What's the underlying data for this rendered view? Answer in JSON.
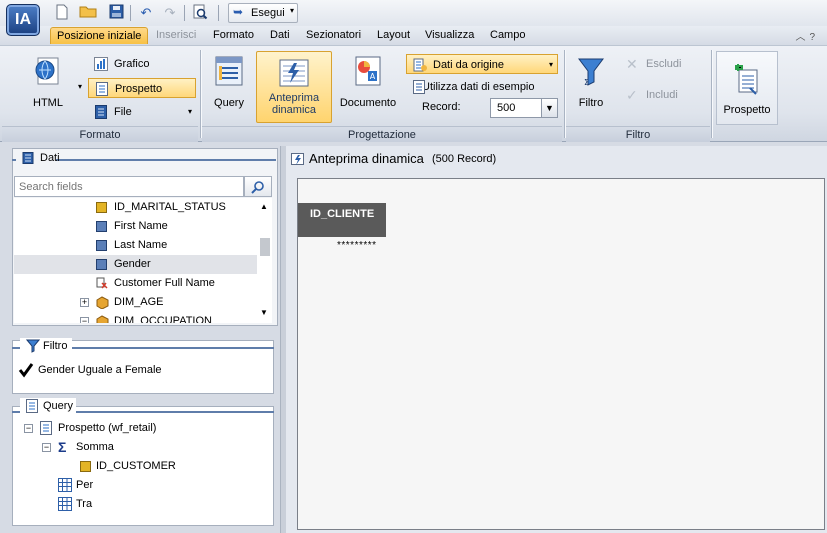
{
  "app": {
    "logo_text": "IA"
  },
  "quick_access": {
    "run_label": "Esegui"
  },
  "menu": {
    "tabs": [
      "Posizione iniziale",
      "Inserisci",
      "Formato",
      "Dati",
      "Sezionatori",
      "Layout",
      "Visualizza",
      "Campo"
    ],
    "active": "Posizione iniziale",
    "disabled": [
      "Inserisci"
    ]
  },
  "ribbon": {
    "formato": {
      "label": "Formato",
      "html": "HTML",
      "grafico": "Grafico",
      "prospetto": "Prospetto",
      "file": "File"
    },
    "progettazione": {
      "label": "Progettazione",
      "query": "Query",
      "anteprima_line1": "Anteprima",
      "anteprima_line2": "dinamica",
      "documento": "Documento",
      "dati_da_origine": "Dati da origine",
      "utilizza_dati": "Utilizza dati di esempio",
      "record_label": "Record:",
      "record_value": "500"
    },
    "filtro": {
      "label": "Filtro",
      "filtro": "Filtro",
      "escludi": "Escludi",
      "includi": "Includi"
    },
    "output": {
      "prospetto": "Prospetto"
    }
  },
  "left": {
    "dati": {
      "title": "Dati",
      "search_placeholder": "Search fields",
      "fields": [
        {
          "label": "ID_MARITAL_STATUS",
          "type": "key"
        },
        {
          "label": "First Name",
          "type": "dim"
        },
        {
          "label": "Last Name",
          "type": "dim"
        },
        {
          "label": "Gender",
          "type": "dim",
          "selected": true
        },
        {
          "label": "Customer Full Name",
          "type": "computed"
        },
        {
          "label": "DIM_AGE",
          "type": "folder"
        },
        {
          "label": "DIM_OCCUPATION",
          "type": "folder"
        }
      ]
    },
    "filtro": {
      "title": "Filtro",
      "item": "Gender Uguale a Female"
    },
    "query": {
      "title": "Query",
      "items": [
        {
          "label": "Prospetto (wf_retail)",
          "level": 0
        },
        {
          "label": "Somma",
          "level": 1
        },
        {
          "label": "ID_CUSTOMER",
          "level": 2
        },
        {
          "label": "Per",
          "level": 1
        },
        {
          "label": "Tra",
          "level": 1
        }
      ]
    }
  },
  "preview": {
    "title": "Anteprima dinamica",
    "subtitle": "(500 Record)",
    "column_header": "ID_CLIENTE",
    "column_value": "*********"
  },
  "colors": {
    "accent_tab": "#f7c146",
    "panel_line": "#5f7daa",
    "header_dark": "#5a5a5a"
  }
}
